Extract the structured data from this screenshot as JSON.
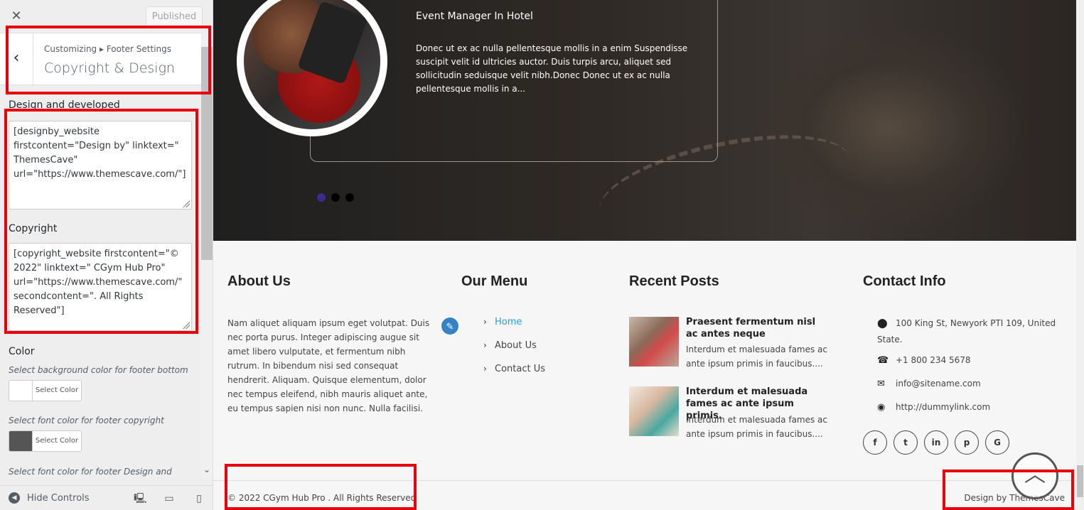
{
  "sidebar": {
    "close_label": "✕",
    "published_label": "Published",
    "breadcrumb": "Customizing ▸ Footer Settings",
    "section_title": "Copyright & Design",
    "design_label": "Design and developed",
    "design_value": "[designby_website firstcontent=\"Design by\" linktext=\" ThemesCave\" url=\"https://www.themescave.com/\"]",
    "copyright_label": "Copyright",
    "copyright_value": "[copyright_website firstcontent=\"© 2022\" linktext=\" CGym Hub Pro\" url=\"https://www.themescave.com/\" secondcontent=\". All Rights Reserved\"]",
    "color_heading": "Color",
    "bg_desc": "Select background color for footer bottom",
    "font_desc": "Select font color for footer copyright",
    "design_font_desc": "Select font color for footer Design and",
    "select_color_label": "Select Color",
    "bg_swatch": "#ffffff",
    "font_swatch": "#555555",
    "hide_controls": "Hide Controls"
  },
  "hero": {
    "name": "Event Manager In Hotel",
    "text": "Donec ut ex ac nulla pellentesque mollis in a enim Suspendisse suscipit velit id ultricies auctor. Duis turpis arcu, aliquet sed sollicitudin seduisque velit nibh.Donec Donec ut ex ac nulla pellentesque mollis in a..."
  },
  "footer": {
    "about_heading": "About Us",
    "about_text": "Nam aliquet aliquam ipsum eget volutpat. Duis nec porta purus. Integer adipiscing augue sit amet libero vulputate, et fermentum nibh rutrum. In bibendum nisi sed consequat hendrerit. Aliquam. Quisque elementum, dolor nec tempus eleifend, nibh mauris aliquet ante, eu tempus sapien nisi non nunc. Nulla facilisi.",
    "menu_heading": "Our Menu",
    "menu": [
      "Home",
      "About Us",
      "Contact Us"
    ],
    "posts_heading": "Recent Posts",
    "posts": [
      {
        "title": "Praesent fermentum nisl ac antes neque",
        "excerpt": "Interdum et malesuada fames ac ante ipsum primis in faucibus...."
      },
      {
        "title": "Interdum et malesuada fames ac ante ipsum primis.",
        "excerpt": "Interdum et malesuada fames ac ante ipsum primis in faucibus...."
      }
    ],
    "contact_heading": "Contact Info",
    "address": "100 King St, Newyork PTI 109, United State.",
    "phone": "+1 800 234 5678",
    "email": "info@sitename.com",
    "website": "http://dummylink.com",
    "social": [
      "f",
      "t",
      "in",
      "p",
      "G"
    ],
    "copyright": "© 2022 CGym Hub Pro . All Rights Reserved",
    "design_by": "Design by ThemesCave"
  },
  "colors": {
    "accent": "#23a0d4",
    "highlight_box": "#e8000b",
    "active_dot": "#3c2b8f"
  }
}
